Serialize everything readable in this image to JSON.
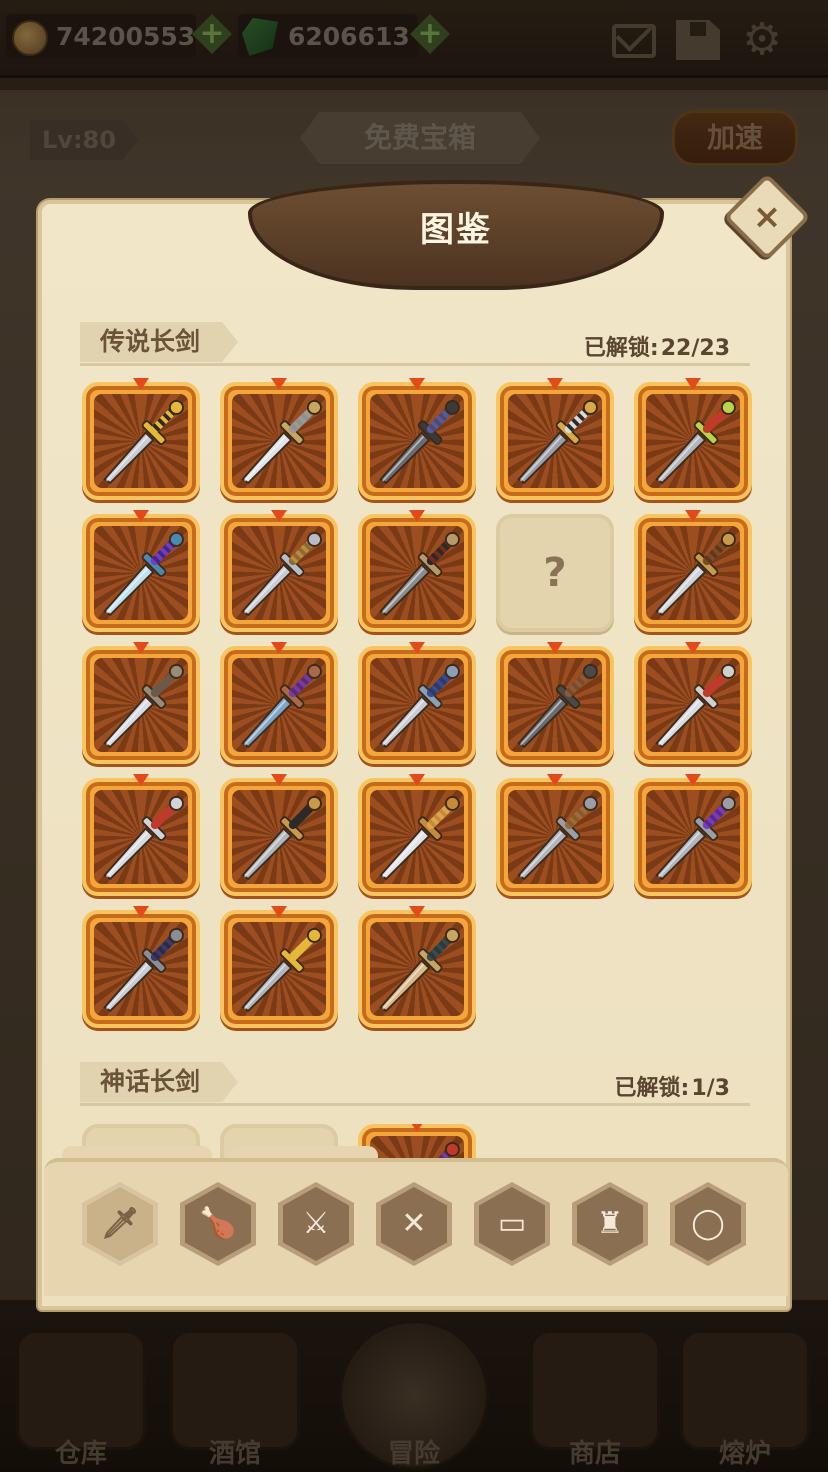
{
  "topbar": {
    "gold": "74200553",
    "gems": "6206613",
    "icons": [
      "coin-icon",
      "plus-icon",
      "gem-icon",
      "plus-icon",
      "mail-icon",
      "save-icon",
      "gear-icon"
    ]
  },
  "header": {
    "level": "Lv:80",
    "banner": "免费宝箱",
    "speed_button": "加速"
  },
  "modal": {
    "title": "图鉴",
    "close_glyph": "×",
    "sections": [
      {
        "name": "传说长剑",
        "unlocked_label": "已解锁:",
        "unlocked_count": "22/23",
        "items": [
          {
            "icon": "sword-gold-guard-icon",
            "locked": false,
            "blade": "#c8ccd6",
            "hilt": "#2a2a2a",
            "guard": "#e6b83a",
            "grip": "#e6b83a"
          },
          {
            "icon": "sword-curved-guard-icon",
            "locked": false,
            "blade": "#dfe3ea",
            "hilt": "#8a8f98",
            "guard": "#c8a560",
            "grip": "#a09a8a"
          },
          {
            "icon": "sword-dark-cross-icon",
            "locked": false,
            "blade": "#6a6c72",
            "hilt": "#4a4a7a",
            "guard": "#3a3a3a",
            "grip": "#5a5a9a"
          },
          {
            "icon": "sword-crescent-guard-icon",
            "locked": false,
            "blade": "#9aa0aa",
            "hilt": "#2a2a2a",
            "guard": "#d9a84a",
            "grip": "#d9d9d9"
          },
          {
            "icon": "sword-green-guard-icon",
            "locked": false,
            "blade": "#b0b5be",
            "hilt": "#c0392b",
            "guard": "#b8d44a",
            "grip": "#c0392b"
          },
          {
            "icon": "sword-ice-purple-icon",
            "locked": false,
            "blade": "#bfe0f2",
            "hilt": "#3a2a8a",
            "guard": "#4a8ab0",
            "grip": "#7a3ac0"
          },
          {
            "icon": "sword-silver-ornate-icon",
            "locked": false,
            "blade": "#c8ccd6",
            "hilt": "#c08a3a",
            "guard": "#b8bcc6",
            "grip": "#8a6a3a"
          },
          {
            "icon": "sword-bronze-cross-icon",
            "locked": false,
            "blade": "#8a8c90",
            "hilt": "#7a2a1a",
            "guard": "#b89a6a",
            "grip": "#2a2a2a"
          },
          {
            "icon": "question-mark-icon",
            "locked": true,
            "glyph": "?"
          },
          {
            "icon": "sword-tribal-icon",
            "locked": false,
            "blade": "#cfd3da",
            "hilt": "#5a3a1a",
            "guard": "#c89a4a",
            "grip": "#7a4a2a"
          },
          {
            "icon": "sword-scimitar-icon",
            "locked": false,
            "blade": "#d7dbe2",
            "hilt": "#6a5a4a",
            "guard": "#9a8a7a",
            "grip": "#6a5a4a"
          },
          {
            "icon": "sword-purple-grip-icon",
            "locked": false,
            "blade": "#7fa4c8",
            "hilt": "#5a2a7a",
            "guard": "#a86a4a",
            "grip": "#7a3aa0"
          },
          {
            "icon": "sword-blue-cross-icon",
            "locked": false,
            "blade": "#c8ccd6",
            "hilt": "#2a3a6a",
            "guard": "#8aa0b8",
            "grip": "#3a4a8a"
          },
          {
            "icon": "sword-dark-blade-icon",
            "locked": false,
            "blade": "#6a6c72",
            "hilt": "#7a4a2a",
            "guard": "#4a4a4a",
            "grip": "#8a5a3a"
          },
          {
            "icon": "sword-red-grip-icon",
            "locked": false,
            "blade": "#d7dbe2",
            "hilt": "#c0392b",
            "guard": "#d0d0d0",
            "grip": "#c0392b"
          },
          {
            "icon": "sword-red-silver-icon",
            "locked": false,
            "blade": "#d7dbe2",
            "hilt": "#c0392b",
            "guard": "#d0d4dc",
            "grip": "#c0392b"
          },
          {
            "icon": "sword-serrated-icon",
            "locked": false,
            "blade": "#b0b5be",
            "hilt": "#2a2a2a",
            "guard": "#c89a4a",
            "grip": "#2a2a2a"
          },
          {
            "icon": "sword-hooked-guard-icon",
            "locked": false,
            "blade": "#dfe3ea",
            "hilt": "#c88a3a",
            "guard": "#c88a3a",
            "grip": "#d9a84a"
          },
          {
            "icon": "sword-plain-cross-icon",
            "locked": false,
            "blade": "#b0b5be",
            "hilt": "#8a5a2a",
            "guard": "#9a9ea6",
            "grip": "#a06a3a"
          },
          {
            "icon": "sword-violet-grip-icon",
            "locked": false,
            "blade": "#b0b5be",
            "hilt": "#5a2a8a",
            "guard": "#9a9ea6",
            "grip": "#7a3ac0"
          },
          {
            "icon": "sword-navy-grip-icon",
            "locked": false,
            "blade": "#c8ccd6",
            "hilt": "#2a2a4a",
            "guard": "#8a8e96",
            "grip": "#3a3a6a"
          },
          {
            "icon": "sword-golden-scroll-icon",
            "locked": false,
            "blade": "#b0b5be",
            "hilt": "#e6b83a",
            "guard": "#e6b83a",
            "grip": "#e6b83a"
          },
          {
            "icon": "sword-wooden-icon",
            "locked": false,
            "blade": "#d9b88a",
            "hilt": "#2a3a3a",
            "guard": "#c8a560",
            "grip": "#3a4a4a"
          }
        ]
      },
      {
        "name": "神话长剑",
        "unlocked_label": "已解锁:",
        "unlocked_count": "1/3",
        "items": [
          {
            "icon": "question-mark-icon",
            "locked": true,
            "glyph": ""
          },
          {
            "icon": "question-mark-icon",
            "locked": true,
            "glyph": ""
          },
          {
            "icon": "sword-mythic-icon",
            "locked": false,
            "blade": "#b0b5be",
            "hilt": "#5a2a7a",
            "guard": "#c0392b",
            "grip": "#7a3aa0"
          }
        ]
      }
    ]
  },
  "tray": {
    "tabs": [
      {
        "icon": "sword-category-icon",
        "glyph": "🗡",
        "active": true
      },
      {
        "icon": "club-category-icon",
        "glyph": "🍗",
        "active": false
      },
      {
        "icon": "dagger-category-icon",
        "glyph": "⚔",
        "active": false
      },
      {
        "icon": "shield-category-icon",
        "glyph": "✕",
        "active": false
      },
      {
        "icon": "book-category-icon",
        "glyph": "▭",
        "active": false
      },
      {
        "icon": "helmet-category-icon",
        "glyph": "♜",
        "active": false
      },
      {
        "icon": "ring-category-icon",
        "glyph": "◯",
        "active": false
      }
    ]
  },
  "bottom_nav": [
    {
      "label": "仓库",
      "icon": "warehouse-icon"
    },
    {
      "label": "酒馆",
      "icon": "tavern-icon"
    },
    {
      "label": "冒险",
      "icon": "adventure-icon"
    },
    {
      "label": "商店",
      "icon": "shop-icon"
    },
    {
      "label": "熔炉",
      "icon": "furnace-icon"
    }
  ]
}
